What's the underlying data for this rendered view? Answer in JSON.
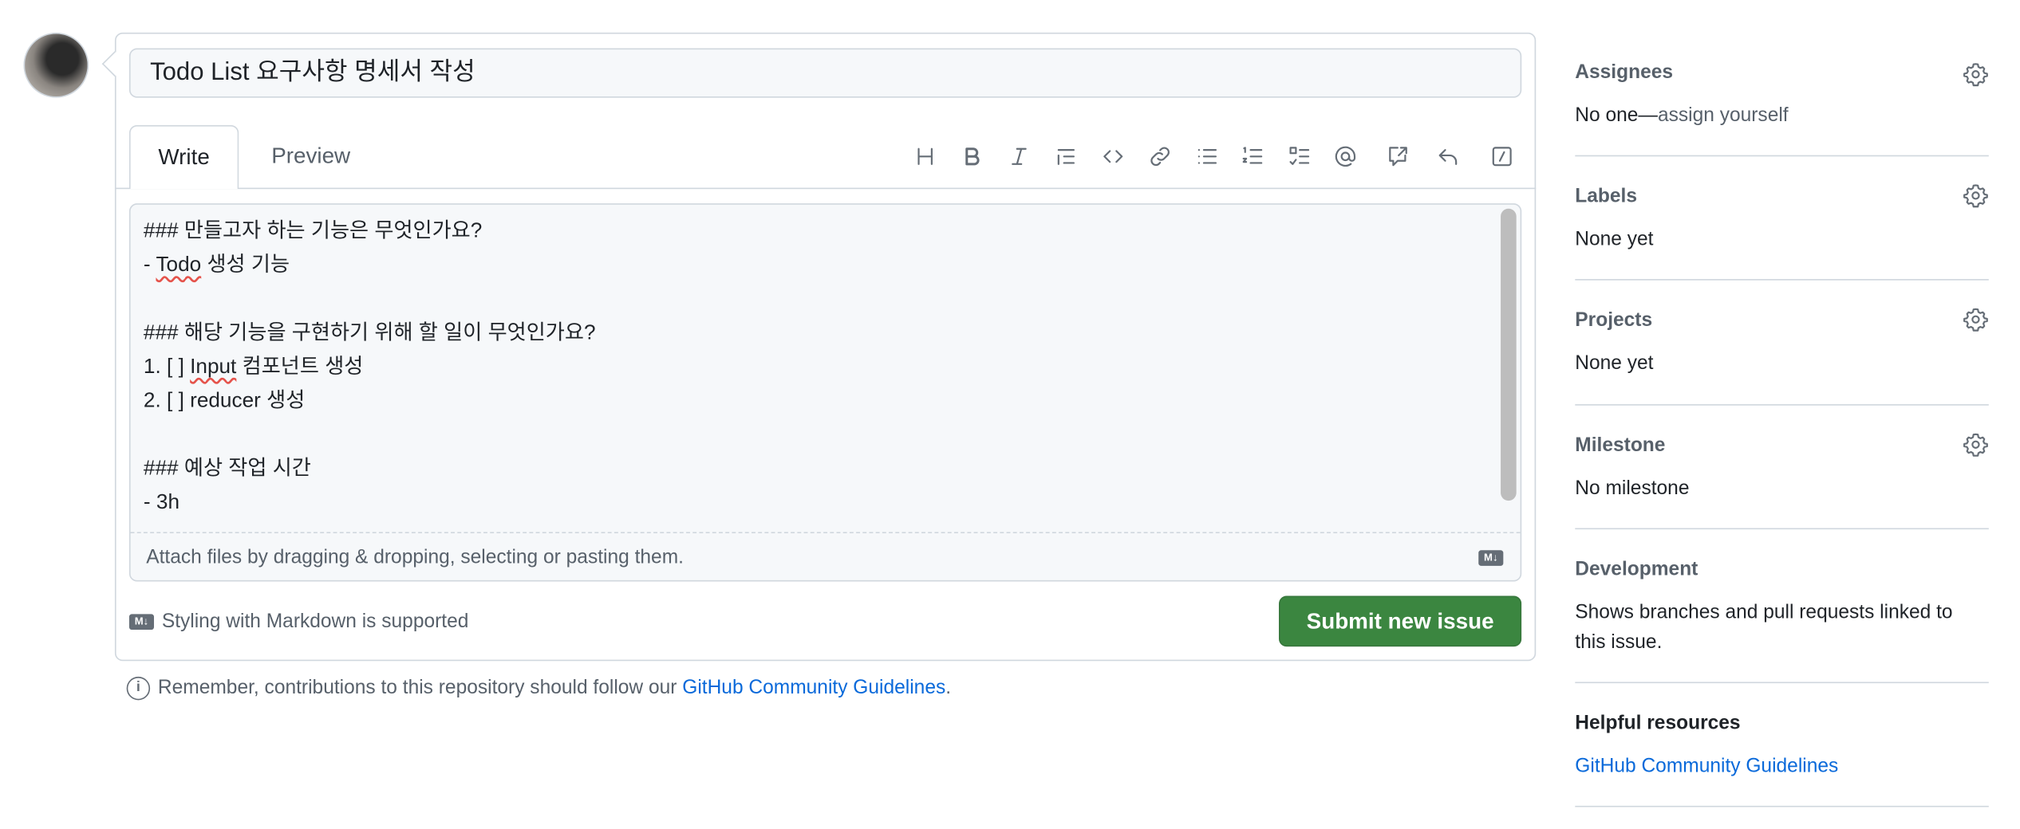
{
  "issue": {
    "title": "Todo List 요구사항 명세서 작성"
  },
  "tabs": [
    {
      "label": "Write"
    },
    {
      "label": "Preview"
    }
  ],
  "toolbar": [
    "heading-icon",
    "bold-icon",
    "italic-icon",
    "quote-icon",
    "code-icon",
    "link-icon",
    "unordered-list-icon",
    "ordered-list-icon",
    "task-list-icon",
    "mention-icon",
    "cross-reference-icon",
    "saved-replies-icon",
    "slash-commands-icon"
  ],
  "body": {
    "lines": [
      "### 만들고자 하는 기능은 무엇인가요?",
      "- |Todo| 생성 기능",
      "",
      "### 해당 기능을 구현하기 위해 할 일이 무엇인가요?",
      "1. [ ] |Input| 컴포넌트 생성",
      "2. [ ] reducer 생성",
      "",
      "### 예상 작업 시간",
      "- 3h"
    ]
  },
  "attach": {
    "text": "Attach files by dragging & dropping, selecting or pasting them.",
    "md_badge": "M↓"
  },
  "footer": {
    "markdown_note": "Styling with Markdown is supported",
    "submit_label": "Submit new issue"
  },
  "note": {
    "prefix": "Remember, contributions to this repository should follow our ",
    "link": "GitHub Community Guidelines",
    "suffix": "."
  },
  "sidebar": {
    "assignees": {
      "title": "Assignees",
      "value_prefix": "No one—",
      "value_link": "assign yourself"
    },
    "labels": {
      "title": "Labels",
      "value": "None yet"
    },
    "projects": {
      "title": "Projects",
      "value": "None yet"
    },
    "milestone": {
      "title": "Milestone",
      "value": "No milestone"
    },
    "development": {
      "title": "Development",
      "value": "Shows branches and pull requests linked to this issue."
    },
    "resources": {
      "title": "Helpful resources",
      "link": "GitHub Community Guidelines"
    }
  },
  "colors": {
    "submit": "#3b8640",
    "link": "#0969da",
    "border": "#d0d7de"
  }
}
